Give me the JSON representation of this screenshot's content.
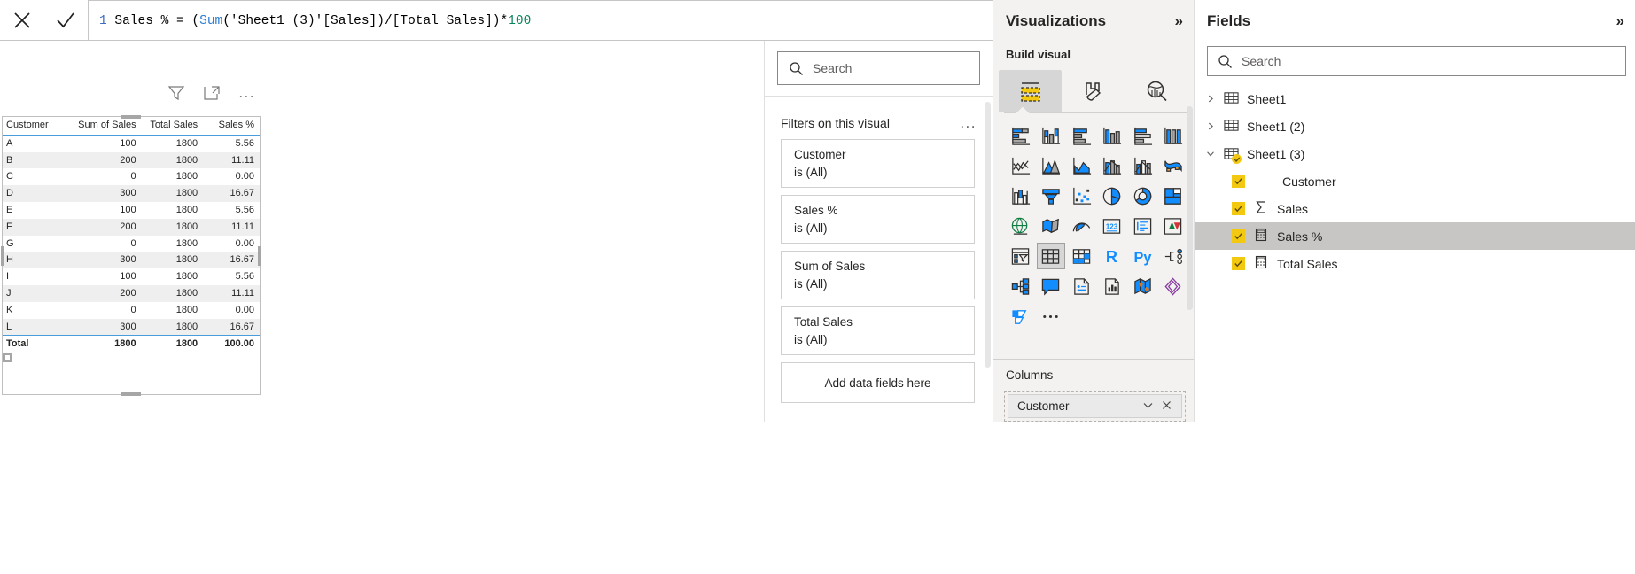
{
  "formula_bar": {
    "cancel_icon": "close-icon",
    "accept_icon": "checkmark-icon",
    "line_number": "1",
    "formula_full": "Sales % = (Sum('Sheet1 (3)'[Sales])/[Total Sales])*100",
    "segments": {
      "before_fn": "Sales % = (",
      "fn": "Sum",
      "after_fn": "('Sheet1 (3)'[Sales])/[Total Sales])*",
      "number": "100"
    },
    "expand_icon": "chevron-down-icon"
  },
  "visual": {
    "header_icons": {
      "filter": "filter-icon",
      "focus_mode": "focus-mode-icon",
      "more_options": "..."
    },
    "table": {
      "columns": [
        "Customer",
        "Sum of Sales",
        "Total Sales",
        "Sales %"
      ],
      "rows": [
        [
          "A",
          "100",
          "1800",
          "5.56"
        ],
        [
          "B",
          "200",
          "1800",
          "11.11"
        ],
        [
          "C",
          "0",
          "1800",
          "0.00"
        ],
        [
          "D",
          "300",
          "1800",
          "16.67"
        ],
        [
          "E",
          "100",
          "1800",
          "5.56"
        ],
        [
          "F",
          "200",
          "1800",
          "11.11"
        ],
        [
          "G",
          "0",
          "1800",
          "0.00"
        ],
        [
          "H",
          "300",
          "1800",
          "16.67"
        ],
        [
          "I",
          "100",
          "1800",
          "5.56"
        ],
        [
          "J",
          "200",
          "1800",
          "11.11"
        ],
        [
          "K",
          "0",
          "1800",
          "0.00"
        ],
        [
          "L",
          "300",
          "1800",
          "16.67"
        ]
      ],
      "total_row": [
        "Total",
        "1800",
        "1800",
        "100.00"
      ]
    }
  },
  "filters_pane": {
    "search_placeholder": "Search",
    "search_icon": "search-icon",
    "title": "Filters on this visual",
    "more_icon": "...",
    "cards": [
      {
        "name": "Customer",
        "value": "is (All)"
      },
      {
        "name": "Sales %",
        "value": "is (All)"
      },
      {
        "name": "Sum of Sales",
        "value": "is (All)"
      },
      {
        "name": "Total Sales",
        "value": "is (All)"
      }
    ],
    "drop_zone": "Add data fields here"
  },
  "visualizations_pane": {
    "title": "Visualizations",
    "collapse_icon": "chevron-double-right-icon",
    "build_visual_label": "Build visual",
    "build_tabs": [
      {
        "name": "fields-tab",
        "icon": "fields-build-icon",
        "selected": true
      },
      {
        "name": "format-tab",
        "icon": "paintbrush-icon",
        "selected": false
      },
      {
        "name": "analytics-tab",
        "icon": "magnifier-chart-icon",
        "selected": false
      }
    ],
    "gallery": [
      {
        "icon": "stacked-bar-chart-icon",
        "selected": false
      },
      {
        "icon": "stacked-column-chart-icon",
        "selected": false
      },
      {
        "icon": "clustered-bar-chart-icon",
        "selected": false
      },
      {
        "icon": "clustered-column-chart-icon",
        "selected": false
      },
      {
        "icon": "100-stacked-bar-chart-icon",
        "selected": false
      },
      {
        "icon": "100-stacked-column-chart-icon",
        "selected": false
      },
      {
        "icon": "line-chart-icon",
        "selected": false
      },
      {
        "icon": "area-chart-icon",
        "selected": false
      },
      {
        "icon": "stacked-area-chart-icon",
        "selected": false
      },
      {
        "icon": "line-stacked-column-chart-icon",
        "selected": false
      },
      {
        "icon": "line-clustered-column-chart-icon",
        "selected": false
      },
      {
        "icon": "ribbon-chart-icon",
        "selected": false
      },
      {
        "icon": "waterfall-chart-icon",
        "selected": false
      },
      {
        "icon": "funnel-chart-icon",
        "selected": false
      },
      {
        "icon": "scatter-chart-icon",
        "selected": false
      },
      {
        "icon": "pie-chart-icon",
        "selected": false
      },
      {
        "icon": "donut-chart-icon",
        "selected": false
      },
      {
        "icon": "treemap-icon",
        "selected": false
      },
      {
        "icon": "map-globe-icon",
        "selected": false
      },
      {
        "icon": "filled-map-icon",
        "selected": false
      },
      {
        "icon": "gauge-icon",
        "selected": false
      },
      {
        "icon": "card-123-icon",
        "selected": false
      },
      {
        "icon": "multi-row-card-icon",
        "selected": false
      },
      {
        "icon": "kpi-icon",
        "selected": false
      },
      {
        "icon": "slicer-icon",
        "selected": false
      },
      {
        "icon": "table-icon",
        "selected": true
      },
      {
        "icon": "matrix-icon",
        "selected": false
      },
      {
        "icon": "r-script-visual-icon",
        "selected": false
      },
      {
        "icon": "python-visual-icon",
        "selected": false
      },
      {
        "icon": "key-influencers-icon",
        "selected": false
      },
      {
        "icon": "decomposition-tree-icon",
        "selected": false
      },
      {
        "icon": "qna-icon",
        "selected": false
      },
      {
        "icon": "smart-narrative-icon",
        "selected": false
      },
      {
        "icon": "paginated-report-icon",
        "selected": false
      },
      {
        "icon": "arcgis-map-icon",
        "selected": false
      },
      {
        "icon": "power-apps-icon",
        "selected": false
      },
      {
        "icon": "power-automate-icon",
        "selected": false
      },
      {
        "icon": "more-visuals-icon",
        "selected": false
      }
    ],
    "r_label": "R",
    "py_label": "Py",
    "card_123_label": "123",
    "more_dots": "...",
    "columns_label": "Columns",
    "columns_well": [
      {
        "field": "Customer",
        "dropdown_icon": "chevron-down-icon",
        "remove_icon": "close-icon"
      }
    ]
  },
  "fields_pane": {
    "title": "Fields",
    "collapse_icon": "chevron-double-right-icon",
    "search_placeholder": "Search",
    "search_icon": "search-icon",
    "tables": [
      {
        "name": "Sheet1",
        "expanded": false,
        "icon": "table-icon",
        "caret": "chevron-right-icon",
        "fields": []
      },
      {
        "name": "Sheet1 (2)",
        "expanded": false,
        "icon": "table-icon",
        "caret": "chevron-right-icon",
        "fields": []
      },
      {
        "name": "Sheet1 (3)",
        "expanded": true,
        "icon": "table-checked-icon",
        "caret": "chevron-down-icon",
        "fields": [
          {
            "label": "Customer",
            "checked": true,
            "icon": "",
            "selected": false
          },
          {
            "label": "Sales",
            "checked": true,
            "icon": "sigma-icon",
            "selected": false
          },
          {
            "label": "Sales %",
            "checked": true,
            "icon": "measure-calculator-icon",
            "selected": true
          },
          {
            "label": "Total Sales",
            "checked": true,
            "icon": "measure-calculator-icon",
            "selected": false
          }
        ]
      }
    ]
  },
  "colors": {
    "accent_yellow": "#f2c811",
    "accent_blue": "#118dff",
    "pane_bg": "#f3f2f1",
    "selection_gray": "#c8c6c4",
    "table_header_rule": "#4a9ddb"
  }
}
